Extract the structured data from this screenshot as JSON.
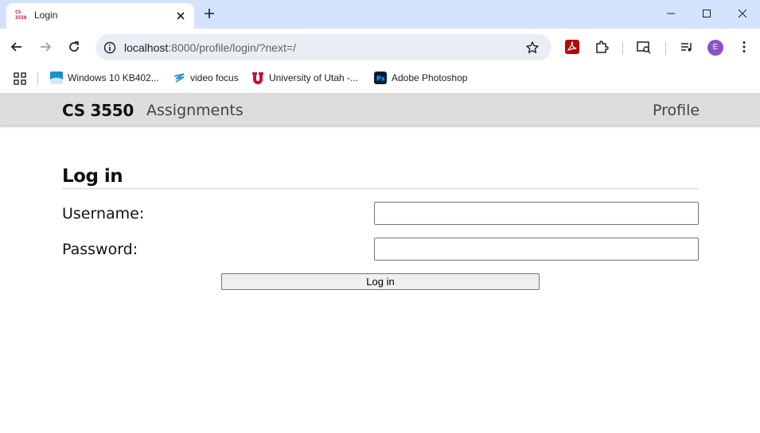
{
  "browser": {
    "tab": {
      "title": "Login",
      "favicon_text": "CS 3550"
    },
    "address": {
      "host": "localhost",
      "path": ":8000/profile/login/?next=/"
    },
    "avatar_letter": "E",
    "accent_color": "#d3e3fd",
    "bookmarks": [
      {
        "label": "Windows 10 KB402...",
        "icon": "windows-icon"
      },
      {
        "label": "video focus",
        "icon": "video-focus-icon"
      },
      {
        "label": "University of Utah -...",
        "icon": "utah-u-icon"
      },
      {
        "label": "Adobe Photoshop",
        "icon": "photoshop-icon"
      }
    ]
  },
  "site": {
    "brand": "CS 3550",
    "nav": {
      "assignments": "Assignments",
      "profile": "Profile"
    },
    "navbar_color": "#dddddd"
  },
  "login": {
    "heading": "Log in",
    "username_label": "Username:",
    "username_value": "",
    "password_label": "Password:",
    "password_value": "",
    "submit_label": "Log in"
  }
}
